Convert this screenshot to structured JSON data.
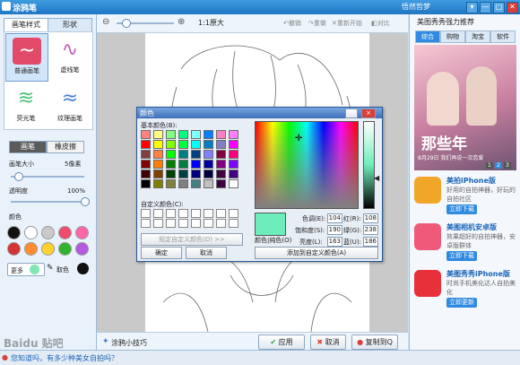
{
  "window": {
    "title": "涂鸦笔",
    "user": "悟然哲梦",
    "buttons": [
      "▾",
      "—",
      "□",
      "✕"
    ]
  },
  "left_panel": {
    "tabs": [
      "画笔样式",
      "形状"
    ],
    "brushes": [
      {
        "label": "普通画笔",
        "color": "#e24a6a",
        "glyph": "~"
      },
      {
        "label": "虚线笔",
        "color": "#c65db8",
        "glyph": "∿"
      },
      {
        "label": "荧光笔",
        "color": "#4fc27a",
        "glyph": "≋"
      },
      {
        "label": "纹理画笔",
        "color": "#4d7fd6",
        "glyph": "≈"
      }
    ],
    "mode_tabs": [
      "画笔",
      "橡皮擦"
    ],
    "size_label": "画笔大小",
    "size_value": "5像素",
    "size_fraction": 0.05,
    "opacity_label": "透明度",
    "opacity_value": "100%",
    "opacity_fraction": 1.0,
    "color_label": "颜色",
    "swatches": [
      "#111111",
      "#ffffff",
      "#c9c9c9",
      "#f04a6c",
      "#ff66aa",
      "#d43434",
      "#ff8c2e",
      "#ffd22e",
      "#2eb42e",
      "#b45ae0",
      "#2e6ee0",
      "#1fc8e0",
      "#2ed68c",
      "#36a8ff",
      "#ffffff"
    ],
    "more_label": "更多",
    "more_color": "#7fe6b4",
    "pick_label": "取色",
    "pick_color": "#111111"
  },
  "toolbar": {
    "zoom_label": "1:1原大",
    "undo": "撤销",
    "redo": "重做",
    "reset": "重新开始",
    "compare": "对比"
  },
  "bottom": {
    "tips": "涂鸦小技巧",
    "apply": "应用",
    "cancel": "取消",
    "copy": "复制到Q"
  },
  "dialog": {
    "title": "颜色",
    "help": "?",
    "close": "×",
    "basic_label": "基本颜色(B):",
    "basic_colors": [
      "#ff8080",
      "#ffff80",
      "#80ff80",
      "#00ff80",
      "#80ffff",
      "#0080ff",
      "#ff80c0",
      "#ff80ff",
      "#ff0000",
      "#ffff00",
      "#80ff00",
      "#00ff40",
      "#00ffff",
      "#0080c0",
      "#8080c0",
      "#ff00ff",
      "#804040",
      "#ff8040",
      "#00ff00",
      "#008080",
      "#004080",
      "#8080ff",
      "#800040",
      "#ff0080",
      "#800000",
      "#ff8000",
      "#008000",
      "#008040",
      "#0000ff",
      "#0000a0",
      "#800080",
      "#8000ff",
      "#400000",
      "#804000",
      "#004000",
      "#004040",
      "#000080",
      "#000040",
      "#400040",
      "#400080",
      "#000000",
      "#808000",
      "#808040",
      "#808080",
      "#408080",
      "#c0c0c0",
      "#400040",
      "#ffffff"
    ],
    "custom_label": "自定义颜色(C):",
    "define_btn": "规定自定义颜色(D) >>",
    "ok": "确定",
    "cancel": "取消",
    "preview_color": "#6cedba",
    "preview_label": "颜色|纯色(O)",
    "hue_label": "色调(E):",
    "hue": "104",
    "sat_label": "饱和度(S):",
    "sat": "190",
    "lum_label": "亮度(L):",
    "lum": "163",
    "red_label": "红(R):",
    "red": "108",
    "green_label": "绿(G):",
    "green": "238",
    "blue_label": "蓝(U):",
    "blue": "186",
    "add_btn": "添加到自定义颜色(A)"
  },
  "right_panel": {
    "title": "美图秀秀强力推荐",
    "tabs": [
      "综合",
      "购物",
      "淘宝",
      "软件"
    ],
    "banner_text1": "那些年",
    "banner_text2": "8月29日 我们再说一次恋爱",
    "banner_pages": [
      "1",
      "2",
      "3"
    ],
    "apps": [
      {
        "name": "美拍iPhone版",
        "desc": "好用的自拍神器，好玩的自拍社区",
        "btn": "立即下载",
        "color": "#f2a628"
      },
      {
        "name": "美图相机安卓版",
        "desc": "效果超好的自拍神器，安卓版群体",
        "btn": "立即下载",
        "color": "#f05a7a"
      },
      {
        "name": "美图秀秀iPhone版",
        "desc": "时尚手机美化达人自拍美化",
        "btn": "立即更新",
        "color": "#e8303a"
      }
    ]
  },
  "statusbar": {
    "text": "您知道吗，有多少种美女自拍吗？",
    "watermark": "Baidu 贴吧"
  }
}
